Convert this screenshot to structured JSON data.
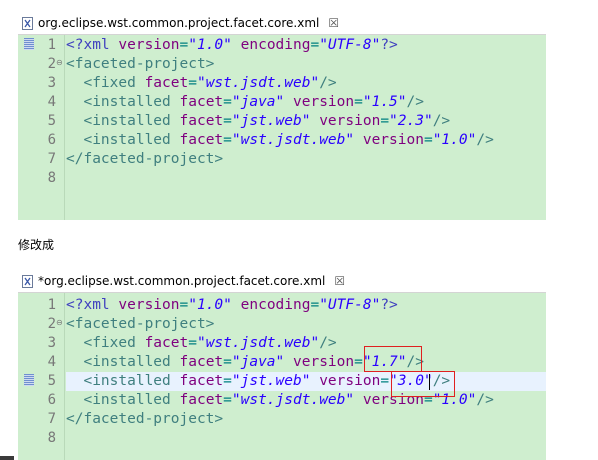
{
  "editor_top": {
    "tab_title": "org.eclipse.wst.common.project.facet.core.xml",
    "close_glyph": "☒",
    "line_numbers": [
      "1",
      "2",
      "3",
      "4",
      "5",
      "6",
      "7",
      "8"
    ],
    "lines": [
      [
        [
          "pi",
          "<?xml "
        ],
        [
          "attr",
          "version"
        ],
        [
          "punct",
          "="
        ],
        [
          "val",
          "\"1.0\""
        ],
        [
          "pi",
          " "
        ],
        [
          "attr",
          "encoding"
        ],
        [
          "punct",
          "="
        ],
        [
          "val",
          "\"UTF-8\""
        ],
        [
          "pi",
          "?>"
        ]
      ],
      [
        [
          "tag",
          "<faceted-project>"
        ]
      ],
      [
        [
          "pi",
          "  "
        ],
        [
          "tag",
          "<fixed "
        ],
        [
          "attr",
          "facet"
        ],
        [
          "punct",
          "="
        ],
        [
          "val",
          "\"wst.jsdt.web\""
        ],
        [
          "tag",
          "/>"
        ]
      ],
      [
        [
          "pi",
          "  "
        ],
        [
          "tag",
          "<installed "
        ],
        [
          "attr",
          "facet"
        ],
        [
          "punct",
          "="
        ],
        [
          "val",
          "\"java\""
        ],
        [
          "pi",
          " "
        ],
        [
          "attr",
          "version"
        ],
        [
          "punct",
          "="
        ],
        [
          "val",
          "\"1.5\""
        ],
        [
          "tag",
          "/>"
        ]
      ],
      [
        [
          "pi",
          "  "
        ],
        [
          "tag",
          "<installed "
        ],
        [
          "attr",
          "facet"
        ],
        [
          "punct",
          "="
        ],
        [
          "val",
          "\"jst.web\""
        ],
        [
          "pi",
          " "
        ],
        [
          "attr",
          "version"
        ],
        [
          "punct",
          "="
        ],
        [
          "val",
          "\"2.3\""
        ],
        [
          "tag",
          "/>"
        ]
      ],
      [
        [
          "pi",
          "  "
        ],
        [
          "tag",
          "<installed "
        ],
        [
          "attr",
          "facet"
        ],
        [
          "punct",
          "="
        ],
        [
          "val",
          "\"wst.jsdt.web\""
        ],
        [
          "pi",
          " "
        ],
        [
          "attr",
          "version"
        ],
        [
          "punct",
          "="
        ],
        [
          "val",
          "\"1.0\""
        ],
        [
          "tag",
          "/>"
        ]
      ],
      [
        [
          "tag",
          "</faceted-project>"
        ]
      ],
      []
    ]
  },
  "caption": "修改成",
  "editor_bottom": {
    "tab_title": "*org.eclipse.wst.common.project.facet.core.xml",
    "close_glyph": "☒",
    "line_numbers": [
      "1",
      "2",
      "3",
      "4",
      "5",
      "6",
      "7",
      "8"
    ],
    "lines": [
      [
        [
          "pi",
          "<?xml "
        ],
        [
          "attr",
          "version"
        ],
        [
          "punct",
          "="
        ],
        [
          "val",
          "\"1.0\""
        ],
        [
          "pi",
          " "
        ],
        [
          "attr",
          "encoding"
        ],
        [
          "punct",
          "="
        ],
        [
          "val",
          "\"UTF-8\""
        ],
        [
          "pi",
          "?>"
        ]
      ],
      [
        [
          "tag",
          "<faceted-project>"
        ]
      ],
      [
        [
          "pi",
          "  "
        ],
        [
          "tag",
          "<fixed "
        ],
        [
          "attr",
          "facet"
        ],
        [
          "punct",
          "="
        ],
        [
          "val",
          "\"wst.jsdt.web\""
        ],
        [
          "tag",
          "/>"
        ]
      ],
      [
        [
          "pi",
          "  "
        ],
        [
          "tag",
          "<installed "
        ],
        [
          "attr",
          "facet"
        ],
        [
          "punct",
          "="
        ],
        [
          "val",
          "\"java\""
        ],
        [
          "pi",
          " "
        ],
        [
          "attr",
          "version"
        ],
        [
          "punct",
          "="
        ],
        [
          "val",
          "\"1.7\""
        ],
        [
          "tag",
          "/>"
        ]
      ],
      [
        [
          "pi",
          "  "
        ],
        [
          "tag",
          "<installed "
        ],
        [
          "attr",
          "facet"
        ],
        [
          "punct",
          "="
        ],
        [
          "val",
          "\"jst.web\""
        ],
        [
          "pi",
          " "
        ],
        [
          "attr",
          "version"
        ],
        [
          "punct",
          "="
        ],
        [
          "val",
          "\"3.0\""
        ],
        [
          "tag",
          "/>"
        ]
      ],
      [
        [
          "pi",
          "  "
        ],
        [
          "tag",
          "<installed "
        ],
        [
          "attr",
          "facet"
        ],
        [
          "punct",
          "="
        ],
        [
          "val",
          "\"wst.jsdt.web\""
        ],
        [
          "pi",
          " "
        ],
        [
          "attr",
          "version"
        ],
        [
          "punct",
          "="
        ],
        [
          "val",
          "\"1.0\""
        ],
        [
          "tag",
          "/>"
        ]
      ],
      [
        [
          "tag",
          "</faceted-project>"
        ]
      ],
      []
    ]
  },
  "colors": {
    "editor_background": "#cfeecf",
    "tag": "#3f7f7f",
    "attribute": "#7f007f",
    "value": "#2a00ff",
    "highlight_box": "#e02020",
    "current_line": "#e8f2fe"
  },
  "icons": {
    "file_icon": "xml-file-icon",
    "close_icon": "close-icon",
    "fold_icon": "fold-collapse-icon"
  }
}
